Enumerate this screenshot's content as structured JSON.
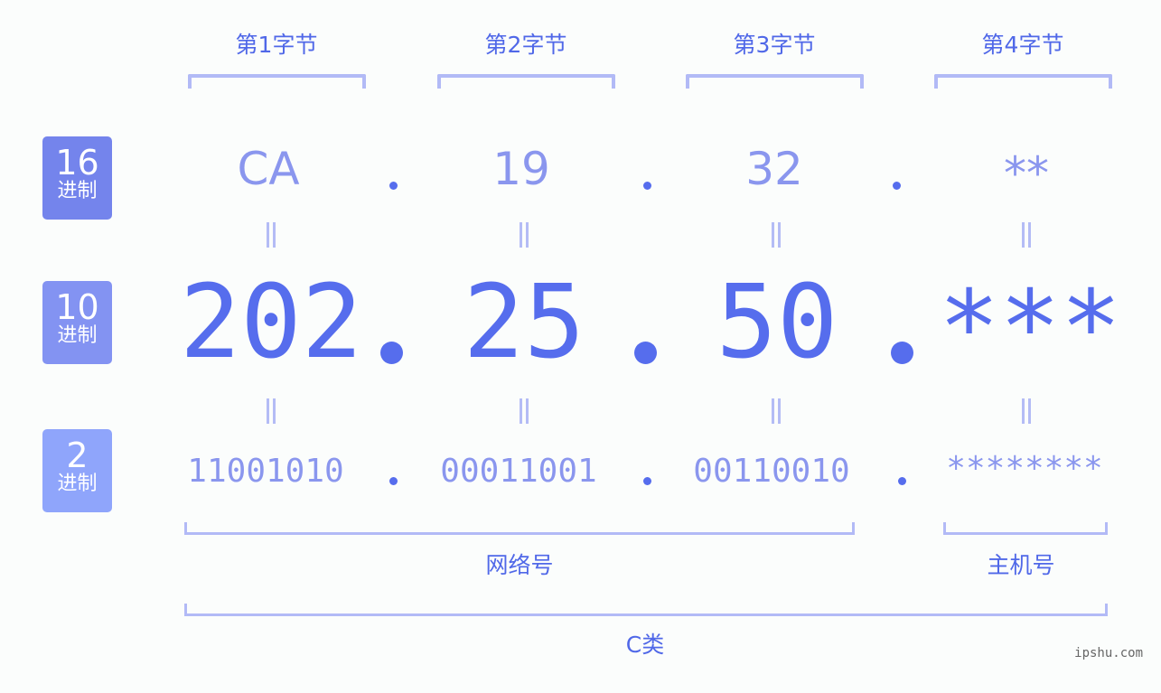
{
  "bytes": [
    {
      "title": "第1字节",
      "hex": "CA",
      "dec": "202",
      "bin": "11001010"
    },
    {
      "title": "第2字节",
      "hex": "19",
      "dec": "25",
      "bin": "00011001"
    },
    {
      "title": "第3字节",
      "hex": "32",
      "dec": "50",
      "bin": "00110010"
    },
    {
      "title": "第4字节",
      "hex": "**",
      "dec": "***",
      "bin": "********"
    }
  ],
  "badges": [
    {
      "num": "16",
      "label": "进制",
      "color": "#7484ec"
    },
    {
      "num": "10",
      "label": "进制",
      "color": "#8393f2"
    },
    {
      "num": "2",
      "label": "进制",
      "color": "#8fa5fb"
    }
  ],
  "labels": {
    "network": "网络号",
    "host": "主机号",
    "class": "C类"
  },
  "watermark": "ipshu.com",
  "colors": {
    "accent": "#566ded",
    "light_text": "#8a96ee",
    "bracket": "#b2baf6",
    "title": "#5068e8"
  }
}
